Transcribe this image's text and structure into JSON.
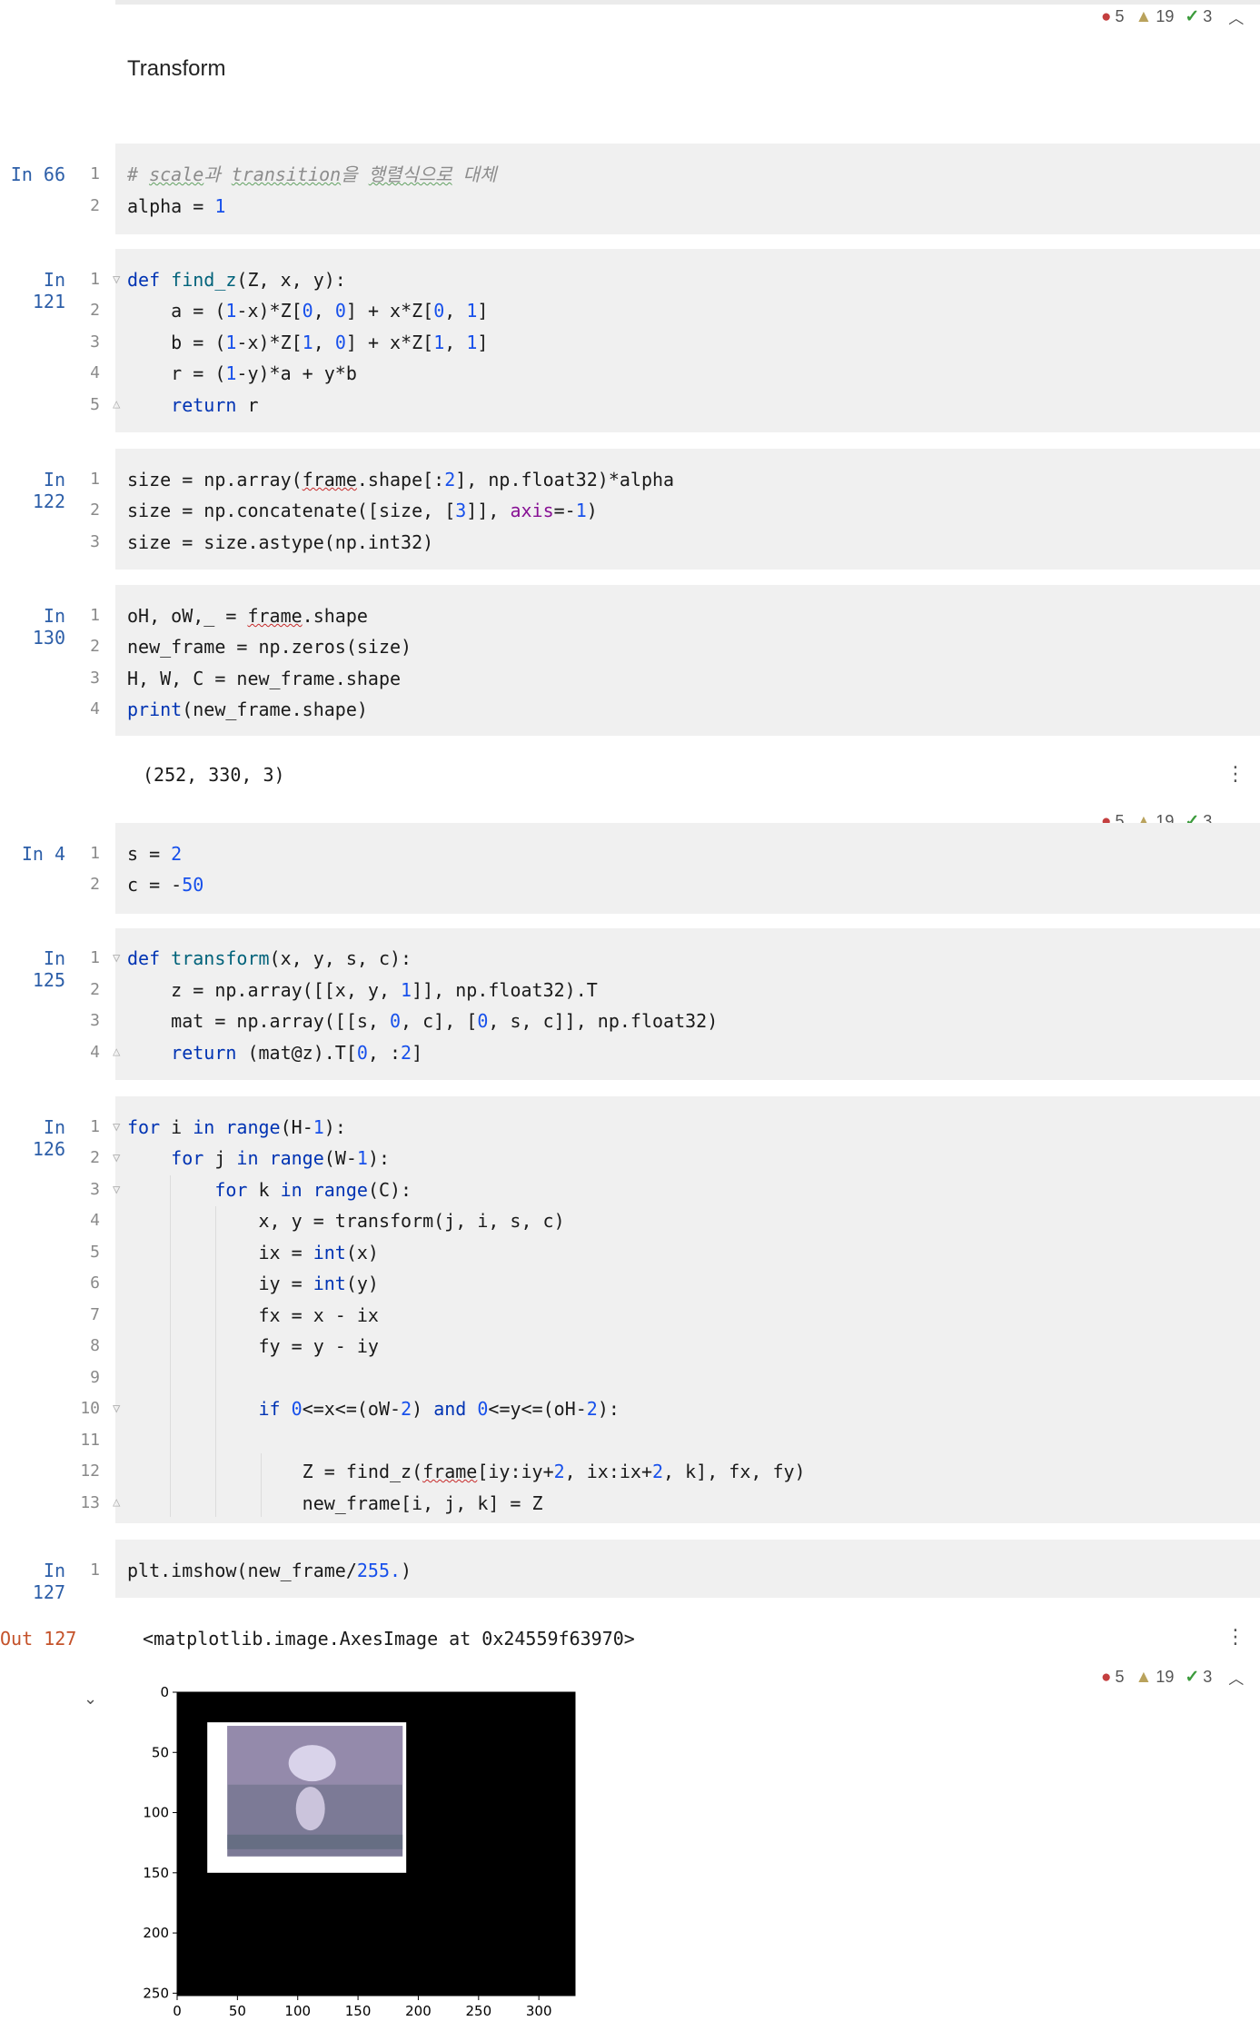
{
  "inspections": {
    "errors": "5",
    "warnings": "19",
    "checks": "3"
  },
  "markdown_title": "Transform",
  "cells": [
    {
      "prompt": "In 66",
      "lines": [
        "# scale과 transition을 행렬식으로 대체",
        "alpha = 1"
      ]
    },
    {
      "prompt": "In 121",
      "lines": [
        "def find_z(Z, x, y):",
        "a = (1-x)*Z[0, 0] + x*Z[0, 1]",
        "b = (1-x)*Z[1, 0] + x*Z[1, 1]",
        "r = (1-y)*a + y*b",
        "return r"
      ]
    },
    {
      "prompt": "In 122",
      "lines": [
        "size = np.array(frame.shape[:2], np.float32)*alpha",
        "size = np.concatenate([size, [3]], axis=-1)",
        "size = size.astype(np.int32)"
      ]
    },
    {
      "prompt": "In 130",
      "lines": [
        "oH, oW,_ = frame.shape",
        "new_frame = np.zeros(size)",
        "H, W, C = new_frame.shape",
        "print(new_frame.shape)"
      ],
      "output": "(252, 330, 3)"
    },
    {
      "prompt": "In 4",
      "lines": [
        "s = 2",
        "c = -50"
      ]
    },
    {
      "prompt": "In 125",
      "lines": [
        "def transform(x, y, s, c):",
        "z = np.array([[x, y, 1]], np.float32).T",
        "mat = np.array([[s, 0, c], [0, s, c]], np.float32)",
        "return (mat@z).T[0, :2]"
      ]
    },
    {
      "prompt": "In 126",
      "lines": [
        "for i in range(H-1):",
        "for j in range(W-1):",
        "for k in range(C):",
        "x, y = transform(j, i, s, c)",
        "ix = int(x)",
        "iy = int(y)",
        "fx = x - ix",
        "fy = y - iy",
        "",
        "if 0<=x<=(oW-2) and 0<=y<=(oH-2):",
        "",
        "Z = find_z(frame[iy:iy+2, ix:ix+2, k], fx, fy)",
        "new_frame[i, j, k] = Z"
      ]
    },
    {
      "prompt": "In 127",
      "lines": [
        "plt.imshow(new_frame/255.)"
      ],
      "out_prompt": "Out 127",
      "output": "<matplotlib.image.AxesImage at 0x24559f63970>"
    }
  ],
  "line_numbers": [
    "1",
    "2",
    "3",
    "4",
    "5",
    "6",
    "7",
    "8",
    "9",
    "10",
    "11",
    "12",
    "13"
  ],
  "chart_data": {
    "type": "image",
    "description_free": true,
    "x_ticks": [
      "0",
      "50",
      "100",
      "150",
      "200",
      "250",
      "300"
    ],
    "y_ticks": [
      "0",
      "50",
      "100",
      "150",
      "200",
      "250"
    ],
    "xlim": [
      0,
      330
    ],
    "ylim": [
      252,
      0
    ],
    "background": "#000000",
    "inset_extent_x": [
      25,
      190
    ],
    "inset_extent_y": [
      25,
      150
    ]
  }
}
